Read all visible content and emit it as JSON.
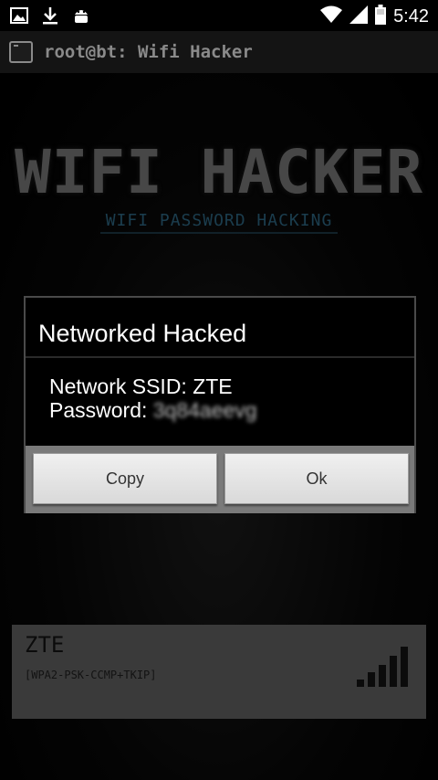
{
  "status_bar": {
    "time": "5:42",
    "icons": [
      "image-icon",
      "download-icon",
      "android-icon",
      "wifi-icon",
      "signal-icon",
      "battery-icon"
    ]
  },
  "title_bar": {
    "title": "root@bt: Wifi Hacker"
  },
  "logo": {
    "title": "WIFI HACKER",
    "subtitle": "WIFI PASSWORD HACKING"
  },
  "dialog": {
    "title": "Networked Hacked",
    "ssid_label": "Network SSID: ZTE",
    "password_label": "Password:",
    "password_value": "3q84aeevg",
    "copy_label": "Copy",
    "ok_label": "Ok"
  },
  "network_item": {
    "ssid": "ZTE",
    "security": "[WPA2-PSK-CCMP+TKIP]"
  },
  "colors": {
    "accent_blue": "#2a5f78",
    "dialog_bg": "#000000",
    "item_bg": "#5a5a5a"
  }
}
